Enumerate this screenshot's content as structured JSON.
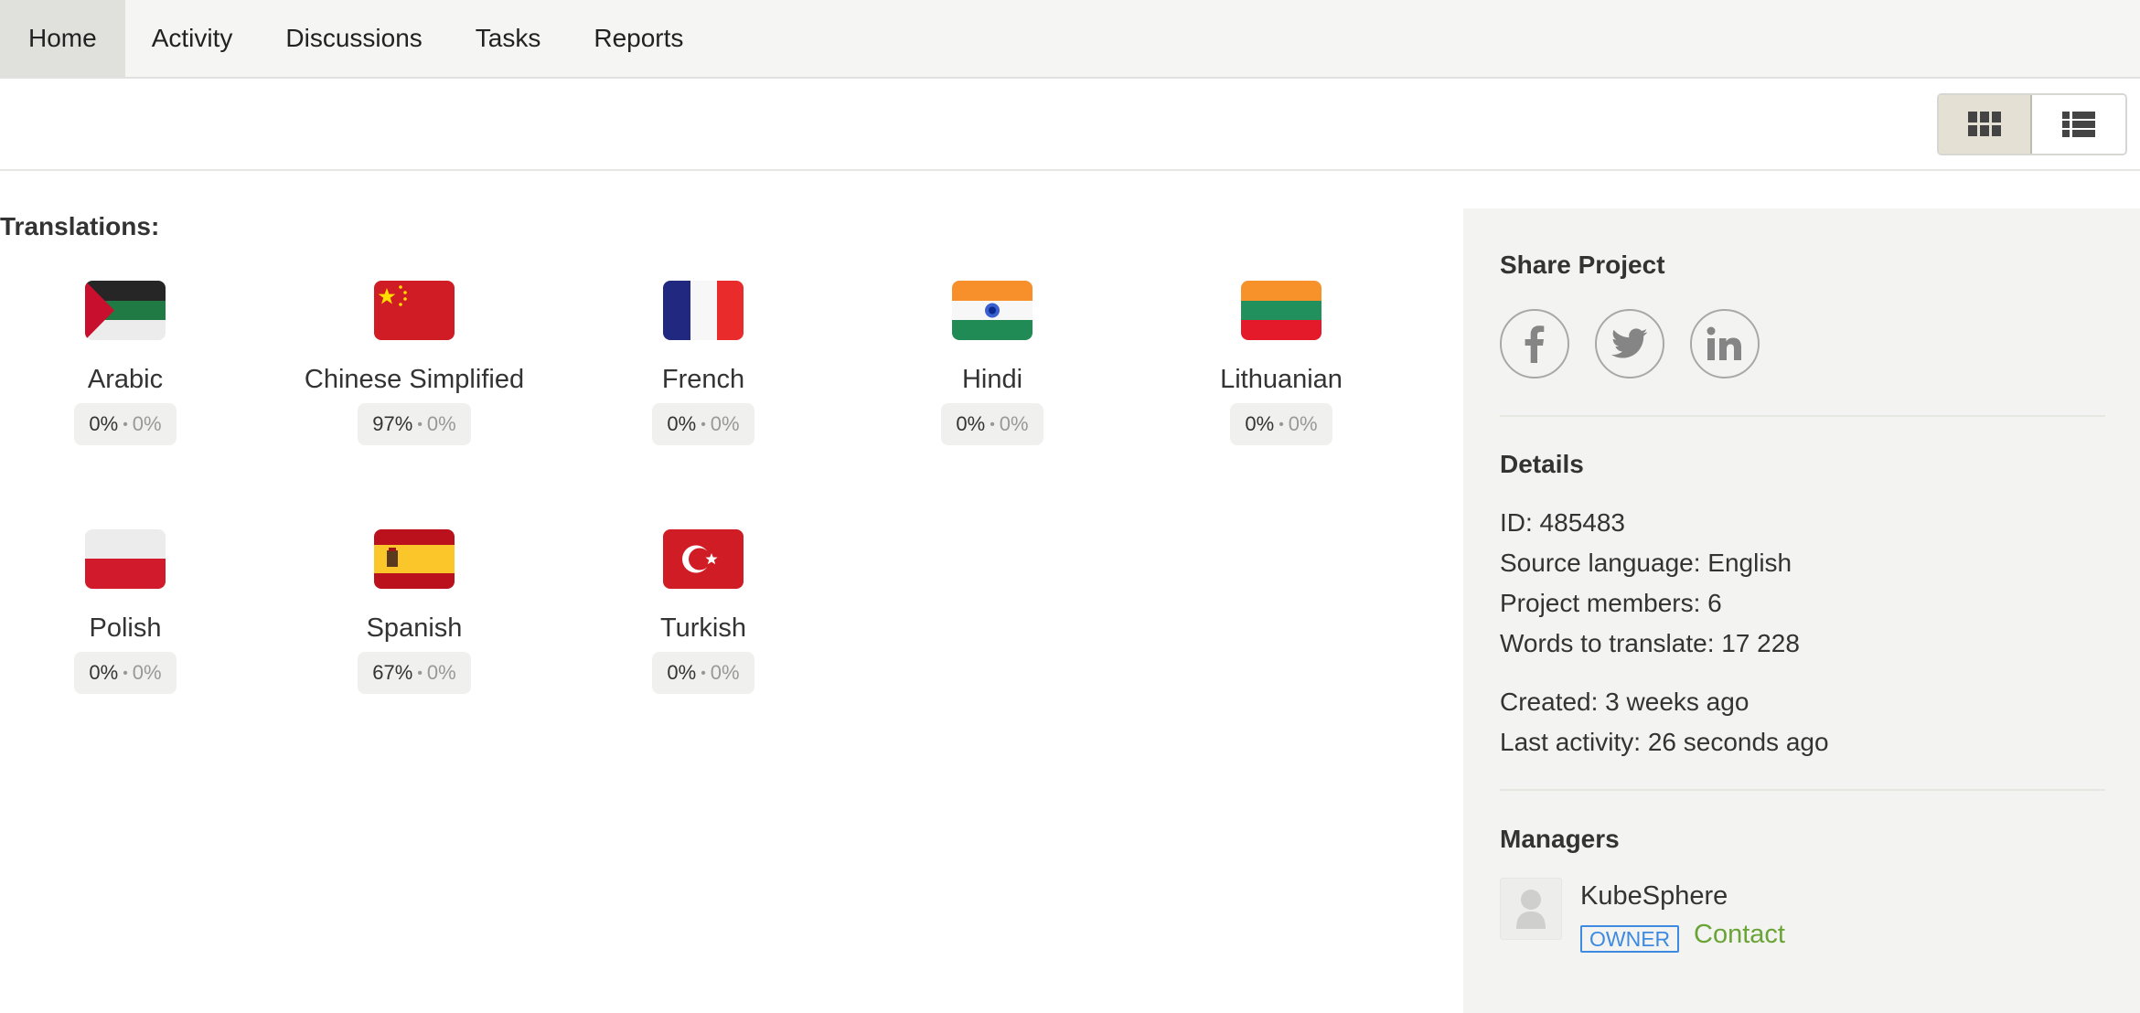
{
  "nav": {
    "tabs": [
      {
        "label": "Home",
        "active": true
      },
      {
        "label": "Activity",
        "active": false
      },
      {
        "label": "Discussions",
        "active": false
      },
      {
        "label": "Tasks",
        "active": false
      },
      {
        "label": "Reports",
        "active": false
      }
    ]
  },
  "view_toggle": {
    "options": [
      {
        "icon": "grid-view-icon",
        "active": true
      },
      {
        "icon": "list-view-icon",
        "active": false
      }
    ]
  },
  "translations": {
    "title": "Translations:",
    "languages": [
      {
        "name": "Arabic",
        "flag": "arabic-flag-icon",
        "translated": "0%",
        "approved": "0%"
      },
      {
        "name": "Chinese Simplified",
        "flag": "china-flag-icon",
        "translated": "97%",
        "approved": "0%"
      },
      {
        "name": "French",
        "flag": "france-flag-icon",
        "translated": "0%",
        "approved": "0%"
      },
      {
        "name": "Hindi",
        "flag": "india-flag-icon",
        "translated": "0%",
        "approved": "0%"
      },
      {
        "name": "Lithuanian",
        "flag": "lithuania-flag-icon",
        "translated": "0%",
        "approved": "0%"
      },
      {
        "name": "Polish",
        "flag": "poland-flag-icon",
        "translated": "0%",
        "approved": "0%"
      },
      {
        "name": "Spanish",
        "flag": "spain-flag-icon",
        "translated": "67%",
        "approved": "0%"
      },
      {
        "name": "Turkish",
        "flag": "turkey-flag-icon",
        "translated": "0%",
        "approved": "0%"
      }
    ],
    "separator": "•"
  },
  "sidebar": {
    "share": {
      "title": "Share Project",
      "networks": [
        "facebook-icon",
        "twitter-icon",
        "linkedin-icon"
      ]
    },
    "details": {
      "title": "Details",
      "id": "ID: 485483",
      "source_language": "Source language: English",
      "members": "Project members: 6",
      "words": "Words to translate: 17 228",
      "created": "Created: 3 weeks ago",
      "last_activity": "Last activity: 26 seconds ago"
    },
    "managers": {
      "title": "Managers",
      "list": [
        {
          "name": "KubeSphere",
          "role": "OWNER",
          "contact_label": "Contact"
        }
      ]
    }
  },
  "colors": {
    "owner_badge": "#3d8ae0",
    "contact_link": "#6aa336",
    "sidebar_bg": "#f3f3f1",
    "nav_bg": "#f5f5f3"
  }
}
